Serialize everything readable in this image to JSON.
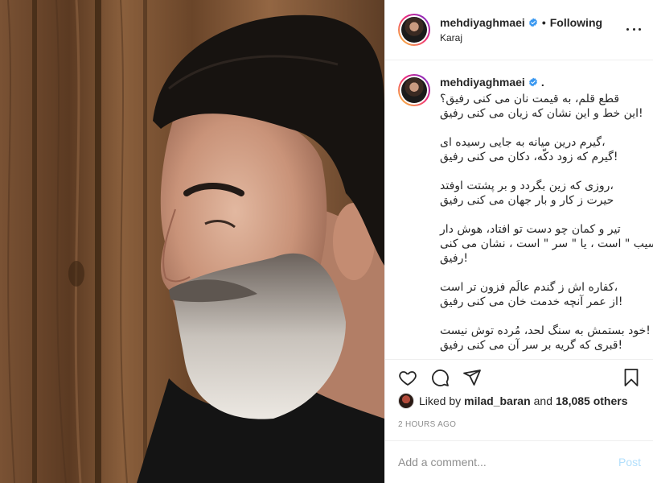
{
  "post": {
    "username": "mehdiyaghmaei",
    "location": "Karaj",
    "dot": "•",
    "following_label": "Following"
  },
  "caption": {
    "username": "mehdiyaghmaei",
    "trailing": ".",
    "stanzas": [
      [
        "قطع قلم، به قیمت نان می کنی رفیق؟",
        "این خط و این نشان که زیان می کنی رفیق!"
      ],
      [
        "گیرم درین میانه به جایی رسیده ای،",
        "گیرم که زود دکّه، دکان می کنی رفیق!"
      ],
      [
        "روزی که زین بگردد و بر پشتت اوفتد،",
        "حیرت ز کار و بار جهان می کنی رفیق"
      ],
      [
        "تیر و کمان چو دست تو افتاد، هوش دار",
        "سیب \" است ، یا \" سر \" است ، نشان می کنی \"",
        "رفیق!"
      ],
      [
        "کفاره اش ز گندم عالَم فزون تر است،",
        "از عمر آنچه خدمت خان می کنی رفیق!"
      ],
      [
        "خود بستمش به سنگ لحد، مُرده توش نیست!",
        "قبری که گریه بر سر آن می کنی رفیق!"
      ]
    ]
  },
  "likes": {
    "prefix": "Liked by",
    "user": "milad_baran",
    "connector": "and",
    "count": "18,085 others"
  },
  "timestamp": "2 HOURS AGO",
  "comment": {
    "placeholder": "Add a comment...",
    "post_label": "Post"
  },
  "icons": {
    "verified": "verified-badge-icon",
    "more": "more-options-icon",
    "like": "heart-icon",
    "comment": "comment-bubble-icon",
    "share": "paper-plane-icon",
    "save": "bookmark-icon"
  },
  "colors": {
    "verified_blue": "#3897f0",
    "post_button": "#b2dffc",
    "muted": "#8e8e8e",
    "text": "#262626"
  }
}
